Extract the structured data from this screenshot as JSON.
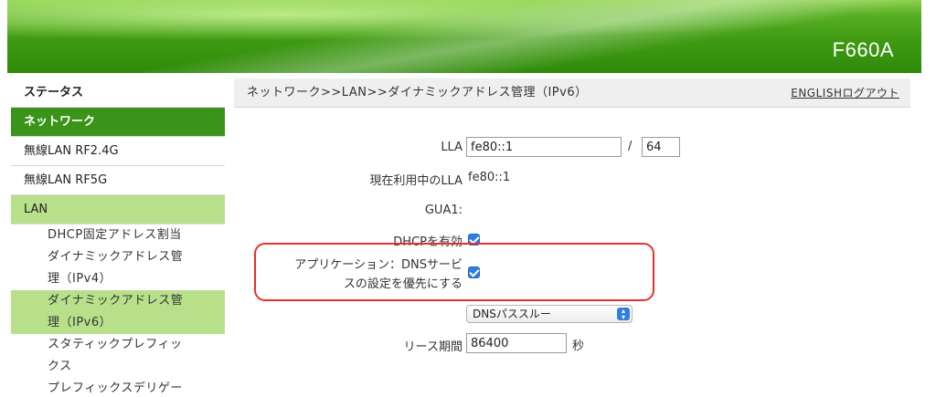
{
  "header": {
    "model": "F660A"
  },
  "sidebar": {
    "items": [
      {
        "label": "ステータス"
      },
      {
        "label": "ネットワーク"
      },
      {
        "label": "無線LAN RF2.4G"
      },
      {
        "label": "無線LAN RF5G"
      },
      {
        "label": "LAN"
      }
    ],
    "sub_items": [
      {
        "lines": [
          "DHCP固定アドレス割当"
        ]
      },
      {
        "lines": [
          "ダイナミックアドレス管",
          "理（IPv4）"
        ]
      },
      {
        "lines": [
          "ダイナミックアドレス管",
          "理（IPv6）"
        ]
      },
      {
        "lines": [
          "スタティックプレフィッ",
          "クス"
        ]
      },
      {
        "lines": [
          "プレフィックスデリゲー"
        ]
      }
    ]
  },
  "content": {
    "breadcrumb": "ネットワーク>>LAN>>ダイナミックアドレス管理（IPv6）",
    "links": {
      "english": "ENGLISH",
      "logout": "ログアウト"
    },
    "form": {
      "lla_label": "LLA",
      "lla_value": "fe80::1",
      "lla_separator": "/",
      "lla_prefix": "64",
      "current_lla_label": "現在利用中のLLA",
      "current_lla_value": "fe80::1",
      "gua1_label": "GUA1:",
      "dhcp_label": "DHCPを有効",
      "dhcp_checked": true,
      "app_dns_label_line1": "アプリケーション：DNSサービ",
      "app_dns_label_line2": "スの設定を優先にする",
      "app_dns_checked": true,
      "dns_select_value": "DNSパススルー",
      "lease_label": "リース期間",
      "lease_value": "86400",
      "lease_unit": "秒"
    }
  }
}
